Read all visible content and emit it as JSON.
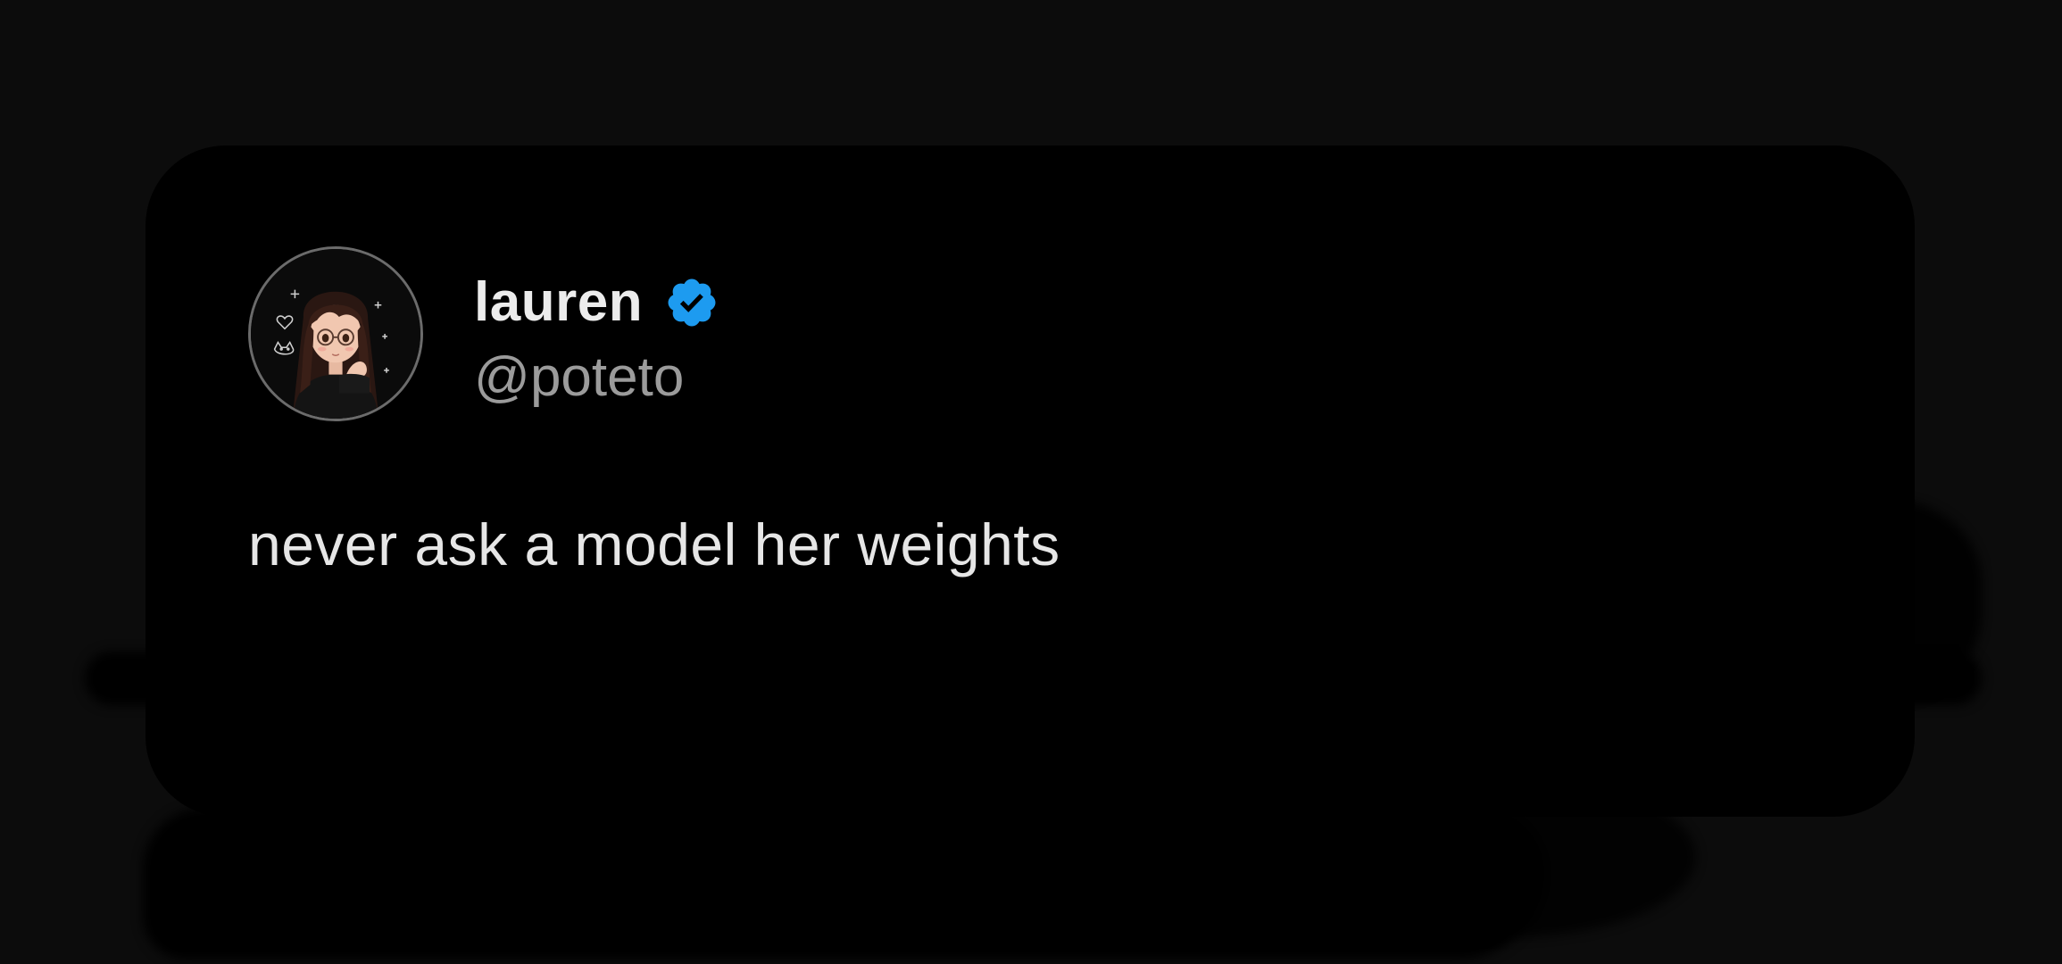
{
  "post": {
    "author": {
      "display_name": "lauren",
      "handle": "@poteto",
      "verified": true,
      "avatar_icon": "anime-girl-avatar-icon"
    },
    "text": "never ask a model her weights"
  },
  "colors": {
    "background": "#0c0c0c",
    "card": "#000000",
    "name": "#ececec",
    "handle": "#9b9b9b",
    "verified_badge": "#1d9bf0",
    "body_text": "#e6e6e6"
  }
}
